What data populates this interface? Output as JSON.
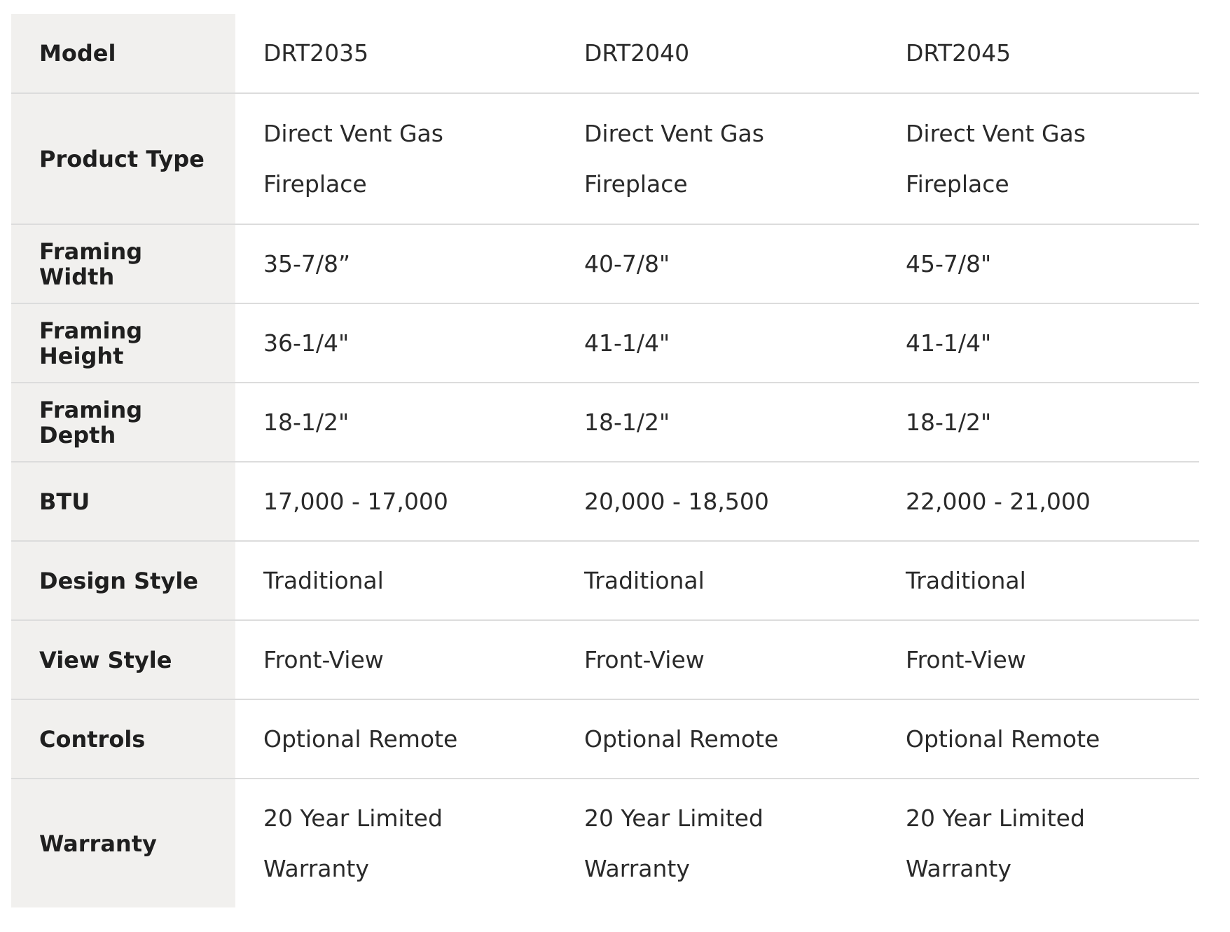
{
  "table": {
    "rows": [
      {
        "label": "Model",
        "values": [
          "DRT2035",
          "DRT2040",
          "DRT2045"
        ]
      },
      {
        "label": "Product Type",
        "values": [
          "Direct Vent Gas Fireplace",
          "Direct Vent Gas Fireplace",
          "Direct Vent Gas Fireplace"
        ]
      },
      {
        "label": "Framing Width",
        "values": [
          "35-7/8”",
          "40-7/8\"",
          "45-7/8\""
        ]
      },
      {
        "label": "Framing Height",
        "values": [
          "36-1/4\"",
          "41-1/4\"",
          "41-1/4\""
        ]
      },
      {
        "label": "Framing Depth",
        "values": [
          "18-1/2\"",
          "18-1/2\"",
          "18-1/2\""
        ]
      },
      {
        "label": "BTU",
        "values": [
          "17,000 - 17,000",
          "20,000 - 18,500",
          "22,000 - 21,000"
        ]
      },
      {
        "label": "Design Style",
        "values": [
          "Traditional",
          "Traditional",
          "Traditional"
        ]
      },
      {
        "label": "View Style",
        "values": [
          "Front-View",
          "Front-View",
          "Front-View"
        ]
      },
      {
        "label": "Controls",
        "values": [
          "Optional Remote",
          "Optional Remote",
          "Optional Remote"
        ]
      },
      {
        "label": "Warranty",
        "values": [
          "20 Year Limited Warranty",
          "20 Year Limited Warranty",
          "20 Year Limited Warranty"
        ]
      }
    ]
  }
}
